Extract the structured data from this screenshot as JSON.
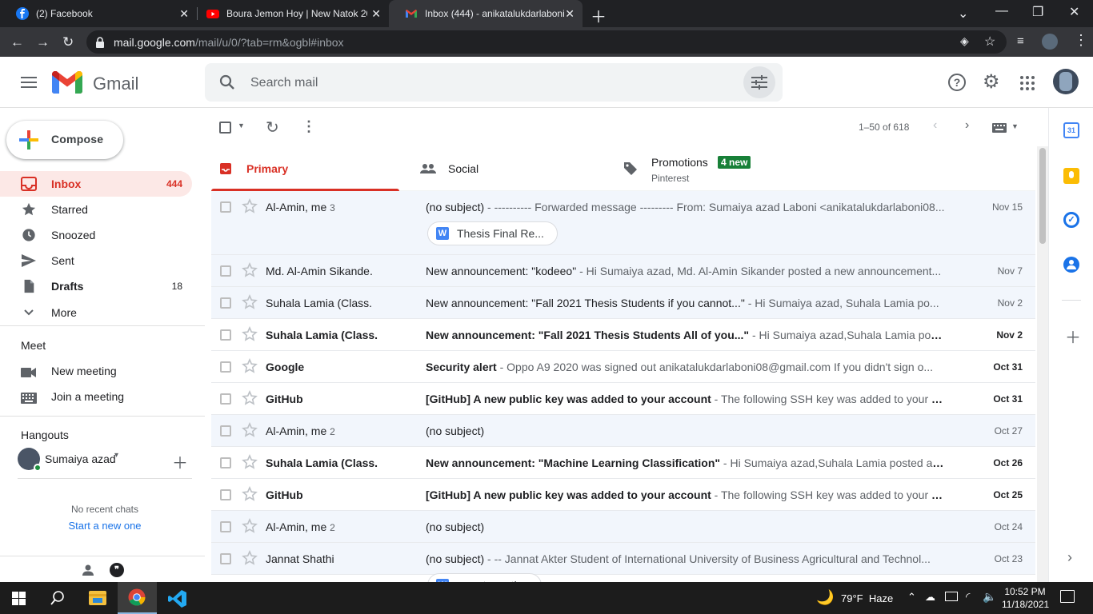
{
  "browser": {
    "tabs": [
      {
        "title": "(2) Facebook",
        "icon": "facebook-icon"
      },
      {
        "title": "Boura Jemon Hoy | New Natok 20",
        "icon": "youtube-icon"
      },
      {
        "title": "Inbox (444) - anikatalukdarlaboni",
        "icon": "gmail-icon"
      }
    ],
    "url_host": "mail.google.com",
    "url_path": "/mail/u/0/?tab=rm&ogbl#inbox"
  },
  "gmail": {
    "app_name": "Gmail",
    "search_placeholder": "Search mail",
    "compose_label": "Compose",
    "nav": [
      {
        "label": "Inbox",
        "count": "444",
        "icon": "inbox-icon",
        "selected": true
      },
      {
        "label": "Starred",
        "count": "",
        "icon": "star-icon"
      },
      {
        "label": "Snoozed",
        "count": "",
        "icon": "clock-icon"
      },
      {
        "label": "Sent",
        "count": "",
        "icon": "send-icon"
      },
      {
        "label": "Drafts",
        "count": "18",
        "icon": "draft-icon"
      },
      {
        "label": "More",
        "count": "",
        "icon": "chevron-down-icon"
      }
    ],
    "meet": {
      "title": "Meet",
      "new_meeting": "New meeting",
      "join_meeting": "Join a meeting"
    },
    "hangouts": {
      "title": "Hangouts",
      "user": "Sumaiya azad",
      "no_chats": "No recent chats",
      "start_new": "Start a new one"
    },
    "pagination": "1–50 of 618",
    "categories": [
      {
        "label": "Primary",
        "sub": "",
        "badge": ""
      },
      {
        "label": "Social",
        "sub": "",
        "badge": ""
      },
      {
        "label": "Promotions",
        "sub": "Pinterest",
        "badge": "4 new"
      }
    ],
    "emails": [
      {
        "sender": "Al-Amin, me",
        "count": "3",
        "subject": "(no subject)",
        "snippet": " - ---------- Forwarded message --------- From: Sumaiya azad Laboni <anikatalukdarlaboni08...",
        "date": "Nov 15",
        "unread": false,
        "attachment": "Thesis Final Re..."
      },
      {
        "sender": "Md. Al-Amin Sikande.",
        "count": "",
        "subject": "New announcement: \"kodeeo\"",
        "snippet": " - Hi Sumaiya azad, Md. Al-Amin Sikander posted a new announcement...",
        "date": "Nov 7",
        "unread": false,
        "attachment": ""
      },
      {
        "sender": "Suhala Lamia (Class.",
        "count": "",
        "subject": "New announcement: \"Fall 2021 Thesis Students if you cannot...\"",
        "snippet": " - Hi Sumaiya azad, Suhala Lamia po...",
        "date": "Nov 2",
        "unread": false,
        "attachment": ""
      },
      {
        "sender": "Suhala Lamia (Class.",
        "count": "",
        "subject": "New announcement: \"Fall 2021 Thesis Students  All of you...\"",
        "snippet": " - Hi Sumaiya azad,Suhala Lamia poste...",
        "date": "Nov 2",
        "unread": true,
        "attachment": ""
      },
      {
        "sender": "Google",
        "count": "",
        "subject": "Security alert",
        "snippet": " - Oppo A9 2020 was signed out anikatalukdarlaboni08@gmail.com If you didn't sign o...",
        "date": "Oct 31",
        "unread": true,
        "attachment": ""
      },
      {
        "sender": "GitHub",
        "count": "",
        "subject": "[GitHub] A new public key was added to your account",
        "snippet": " - The following SSH key was added to your ac...",
        "date": "Oct 31",
        "unread": true,
        "attachment": ""
      },
      {
        "sender": "Al-Amin, me",
        "count": "2",
        "subject": "(no subject)",
        "snippet": "",
        "date": "Oct 27",
        "unread": false,
        "attachment": ""
      },
      {
        "sender": "Suhala Lamia (Class.",
        "count": "",
        "subject": "New announcement: \"Machine Learning Classification\"",
        "snippet": " - Hi Sumaiya azad,Suhala Lamia posted a ne...",
        "date": "Oct 26",
        "unread": true,
        "attachment": ""
      },
      {
        "sender": "GitHub",
        "count": "",
        "subject": "[GitHub] A new public key was added to your account",
        "snippet": " - The following SSH key was added to your ac...",
        "date": "Oct 25",
        "unread": true,
        "attachment": ""
      },
      {
        "sender": "Al-Amin, me",
        "count": "2",
        "subject": "(no subject)",
        "snippet": "",
        "date": "Oct 24",
        "unread": false,
        "attachment": ""
      },
      {
        "sender": "Jannat Shathi",
        "count": "",
        "subject": "(no subject)",
        "snippet": " - -- Jannat Akter Student of International University of Business Agricultural and Technol...",
        "date": "Oct 23",
        "unread": false,
        "attachment": "report practice"
      }
    ]
  },
  "taskbar": {
    "weather": "79°F  Haze",
    "time": "10:52 PM",
    "date": "11/18/2021"
  },
  "colors": {
    "gmail_red": "#d93025",
    "promo_badge": "#188038",
    "tab_bg": "#202124"
  }
}
